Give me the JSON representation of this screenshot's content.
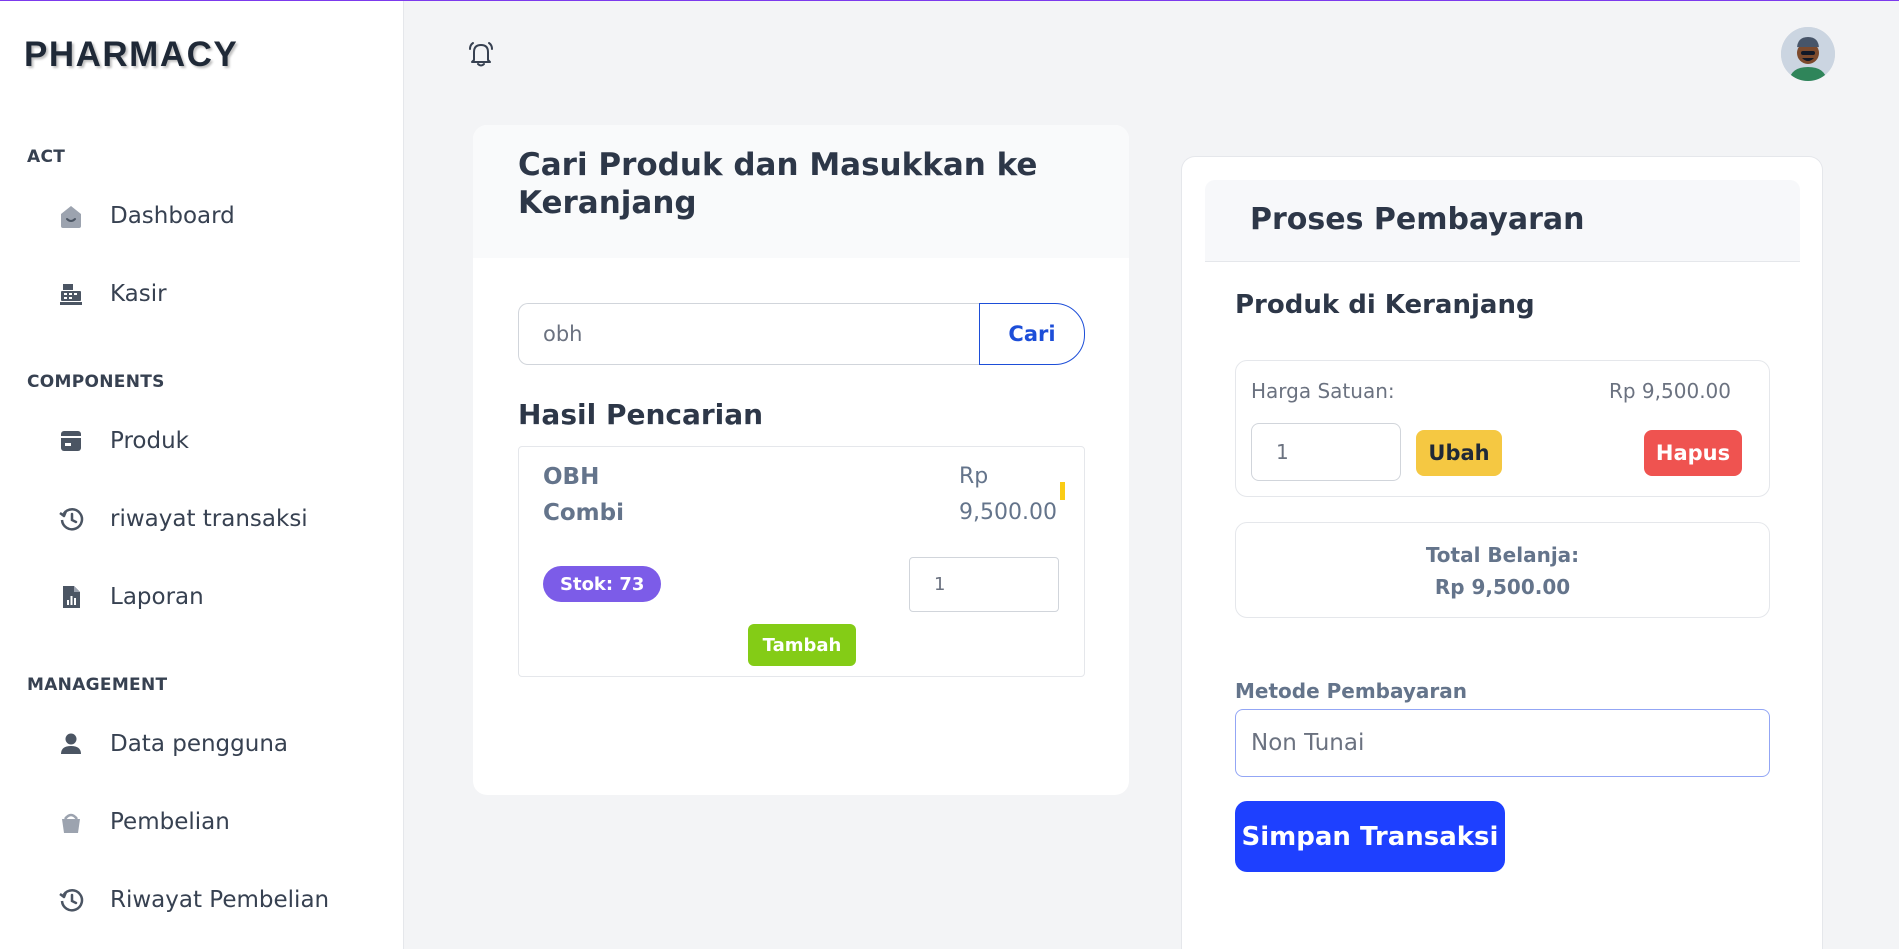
{
  "app": {
    "brand": "PHARMACY"
  },
  "sidebar": {
    "sections": {
      "act": "ACT",
      "components": "COMPONENTS",
      "management": "MANAGEMENT"
    },
    "items": [
      {
        "label": "Dashboard",
        "icon": "home-icon"
      },
      {
        "label": "Kasir",
        "icon": "cash-register-icon"
      },
      {
        "label": "Produk",
        "icon": "store-icon"
      },
      {
        "label": "riwayat transaksi",
        "icon": "history-icon"
      },
      {
        "label": "Laporan",
        "icon": "report-icon"
      },
      {
        "label": "Data pengguna",
        "icon": "user-icon"
      },
      {
        "label": "Pembelian",
        "icon": "basket-icon"
      },
      {
        "label": "Riwayat Pembelian",
        "icon": "history-icon"
      }
    ]
  },
  "search": {
    "title": "Cari Produk dan Masukkan ke Keranjang",
    "query": "obh",
    "button": "Cari",
    "results_title": "Hasil Pencarian",
    "results": [
      {
        "name": "OBH Combi",
        "price": "Rp 9,500.00",
        "stock": "Stok: 73",
        "qty": "1",
        "add_label": "Tambah"
      }
    ]
  },
  "payment": {
    "title": "Proses Pembayaran",
    "cart_title": "Produk di Keranjang",
    "cart": [
      {
        "unit_label": "Harga Satuan:",
        "unit_price": "Rp 9,500.00",
        "qty": "1",
        "edit_label": "Ubah",
        "delete_label": "Hapus"
      }
    ],
    "total_label": "Total Belanja:",
    "total_value": "Rp 9,500.00",
    "method_label": "Metode Pembayaran",
    "method_value": "Non Tunai",
    "save_label": "Simpan Transaksi"
  },
  "colors": {
    "accent": "#1e40ff",
    "stock_badge": "#7c5ce8",
    "add_button": "#84cc16",
    "edit_button": "#f5c842",
    "delete_button": "#ef5350"
  }
}
